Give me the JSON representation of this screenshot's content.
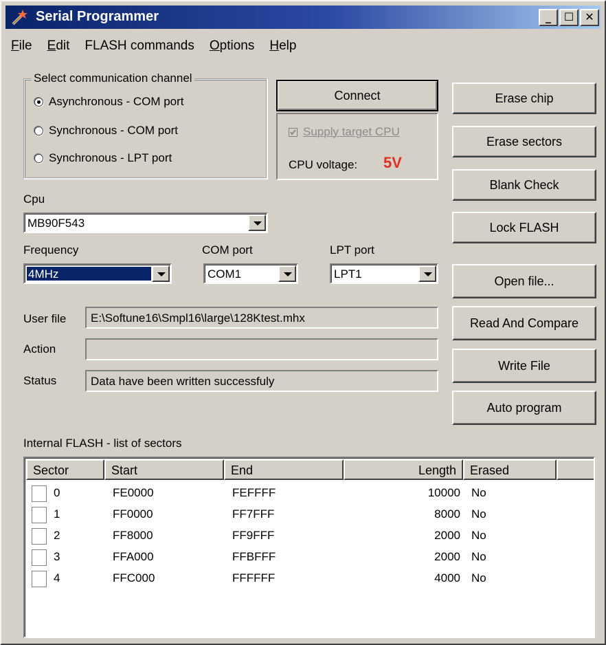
{
  "window": {
    "title": "Serial Programmer"
  },
  "menu": {
    "file": "File",
    "edit": "Edit",
    "flash": "FLASH commands",
    "options": "Options",
    "help": "Help"
  },
  "channel": {
    "caption": "Select communication channel",
    "options": [
      "Asynchronous - COM port",
      "Synchronous - COM port",
      "Synchronous - LPT port"
    ],
    "selected": "Asynchronous - COM port"
  },
  "connect": {
    "label": "Connect",
    "supply_label": "Supply target CPU",
    "voltage_label": "CPU voltage:",
    "voltage_value": "5V",
    "voltage_color": "#e03020"
  },
  "cpu": {
    "label": "Cpu",
    "value": "MB90F543"
  },
  "frequency": {
    "label": "Frequency",
    "value": "4MHz"
  },
  "com_port": {
    "label": "COM port",
    "value": "COM1"
  },
  "lpt_port": {
    "label": "LPT port",
    "value": "LPT1"
  },
  "user_file": {
    "label": "User file",
    "value": "E:\\Softune16\\Smpl16\\large\\128Ktest.mhx"
  },
  "action": {
    "label": "Action",
    "value": ""
  },
  "status": {
    "label": "Status",
    "value": "Data have been written successfuly"
  },
  "buttons": {
    "erase_chip": "Erase chip",
    "erase_sectors": "Erase sectors",
    "blank_check": "Blank Check",
    "lock_flash": "Lock FLASH",
    "open_file": "Open file...",
    "read_compare": "Read And Compare",
    "write_file": "Write File",
    "auto_program": "Auto program"
  },
  "sectors": {
    "caption": "Internal FLASH - list of sectors",
    "headers": {
      "sector": "Sector",
      "start": "Start",
      "end": "End",
      "length": "Length",
      "erased": "Erased"
    },
    "rows": [
      {
        "sector": "0",
        "start": "FE0000",
        "end": "FEFFFF",
        "length": "10000",
        "erased": "No"
      },
      {
        "sector": "1",
        "start": "FF0000",
        "end": "FF7FFF",
        "length": "8000",
        "erased": "No"
      },
      {
        "sector": "2",
        "start": "FF8000",
        "end": "FF9FFF",
        "length": "2000",
        "erased": "No"
      },
      {
        "sector": "3",
        "start": "FFA000",
        "end": "FFBFFF",
        "length": "2000",
        "erased": "No"
      },
      {
        "sector": "4",
        "start": "FFC000",
        "end": "FFFFFF",
        "length": "4000",
        "erased": "No"
      }
    ]
  }
}
